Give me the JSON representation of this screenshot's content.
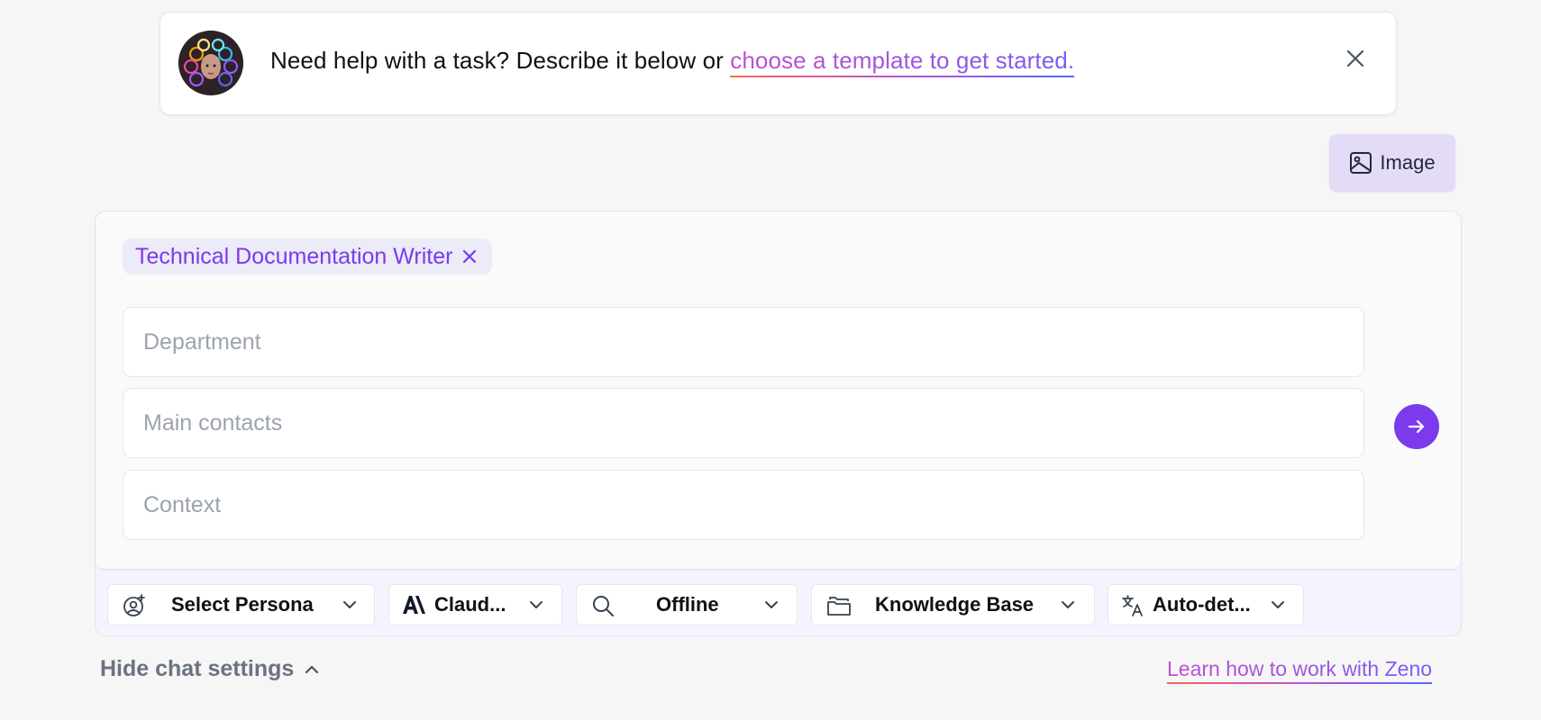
{
  "banner": {
    "avatar_icon": "ai-assistant-avatar",
    "text": "Need help with a task? Describe it below or ",
    "link": "choose a template to get started.",
    "close_icon": "close-icon"
  },
  "image_button": {
    "label": "Image",
    "icon": "image-icon"
  },
  "form": {
    "persona_chip": {
      "label": "Technical Documentation Writer",
      "icon": "close-icon"
    },
    "fields": [
      {
        "placeholder": "Department",
        "value": ""
      },
      {
        "placeholder": "Main contacts",
        "value": ""
      },
      {
        "placeholder": "Context",
        "value": ""
      }
    ],
    "send_icon": "arrow-right-icon"
  },
  "toolbar": {
    "persona": {
      "label": "Select Persona",
      "icon": "persona-icon"
    },
    "model": {
      "label": "Claud...",
      "icon": "anthropic-icon"
    },
    "search": {
      "label": "Offline",
      "icon": "search-icon"
    },
    "knowledge": {
      "label": "Knowledge Base",
      "icon": "folder-icon"
    },
    "language": {
      "label": "Auto-det...",
      "icon": "translate-icon"
    }
  },
  "footer": {
    "hide_settings": "Hide chat settings",
    "learn_link": "Learn how to work with Zeno"
  },
  "colors": {
    "accent": "#7c3aed",
    "image_button_bg": "#e4dcf7",
    "chip_bg": "#ecebf8"
  }
}
